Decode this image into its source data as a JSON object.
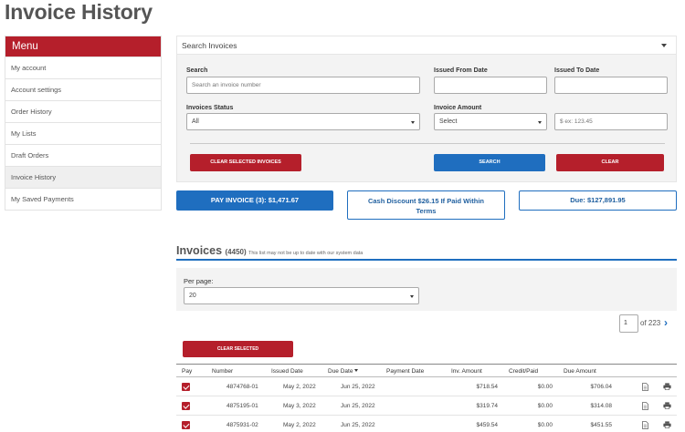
{
  "page": {
    "title": "Invoice History"
  },
  "sidebar": {
    "header": "Menu",
    "items": [
      {
        "label": "My account",
        "active": false
      },
      {
        "label": "Account settings",
        "active": false
      },
      {
        "label": "Order History",
        "active": false
      },
      {
        "label": "My Lists",
        "active": false
      },
      {
        "label": "Draft Orders",
        "active": false
      },
      {
        "label": "Invoice History",
        "active": true
      },
      {
        "label": "My Saved Payments",
        "active": false
      }
    ]
  },
  "search": {
    "title": "Search Invoices",
    "search_label": "Search",
    "search_placeholder": "Search an invoice number",
    "from_label": "Issued From Date",
    "to_label": "Issued To Date",
    "status_label": "Invoices Status",
    "status_value": "All",
    "amount_label": "Invoice Amount",
    "amount_value": "Select",
    "amount_placeholder": "$ ex: 123.45",
    "clear_selected_label": "CLEAR SELECTED INVOICES",
    "search_button": "SEARCH",
    "clear_button": "CLEAR"
  },
  "summary": {
    "pay_label": "PAY INVOICE (3): $1,471.67",
    "discount_label": "Cash Discount $26.15 If Paid Within Terms",
    "due_label": "Due: $127,891.95"
  },
  "invoices": {
    "title": "Invoices",
    "count": "(4450)",
    "note": "This list may not be up to date with our system data",
    "per_page_label": "Per page:",
    "per_page_value": "20",
    "page_current": "1",
    "page_of": "of 223",
    "clear_selected": "CLEAR SELECTED",
    "columns": [
      "Pay",
      "Number",
      "Issued Date",
      "Due Date",
      "Payment Date",
      "Inv. Amount",
      "Credit/Paid",
      "Due Amount"
    ],
    "rows": [
      {
        "number": "4874768-01",
        "issued": "May 2, 2022",
        "due": "Jun 25, 2022",
        "payment": "",
        "amount": "$718.54",
        "credit": "$0.00",
        "due_amount": "$706.04"
      },
      {
        "number": "4875195-01",
        "issued": "May 3, 2022",
        "due": "Jun 25, 2022",
        "payment": "",
        "amount": "$319.74",
        "credit": "$0.00",
        "due_amount": "$314.08"
      },
      {
        "number": "4875931-02",
        "issued": "May 2, 2022",
        "due": "Jun 25, 2022",
        "payment": "",
        "amount": "$459.54",
        "credit": "$0.00",
        "due_amount": "$451.55"
      }
    ]
  },
  "icons": {
    "doc": "document-icon",
    "print": "printer-icon"
  },
  "colors": {
    "brand_red": "#b51f2b",
    "brand_blue": "#1f6ebf"
  }
}
